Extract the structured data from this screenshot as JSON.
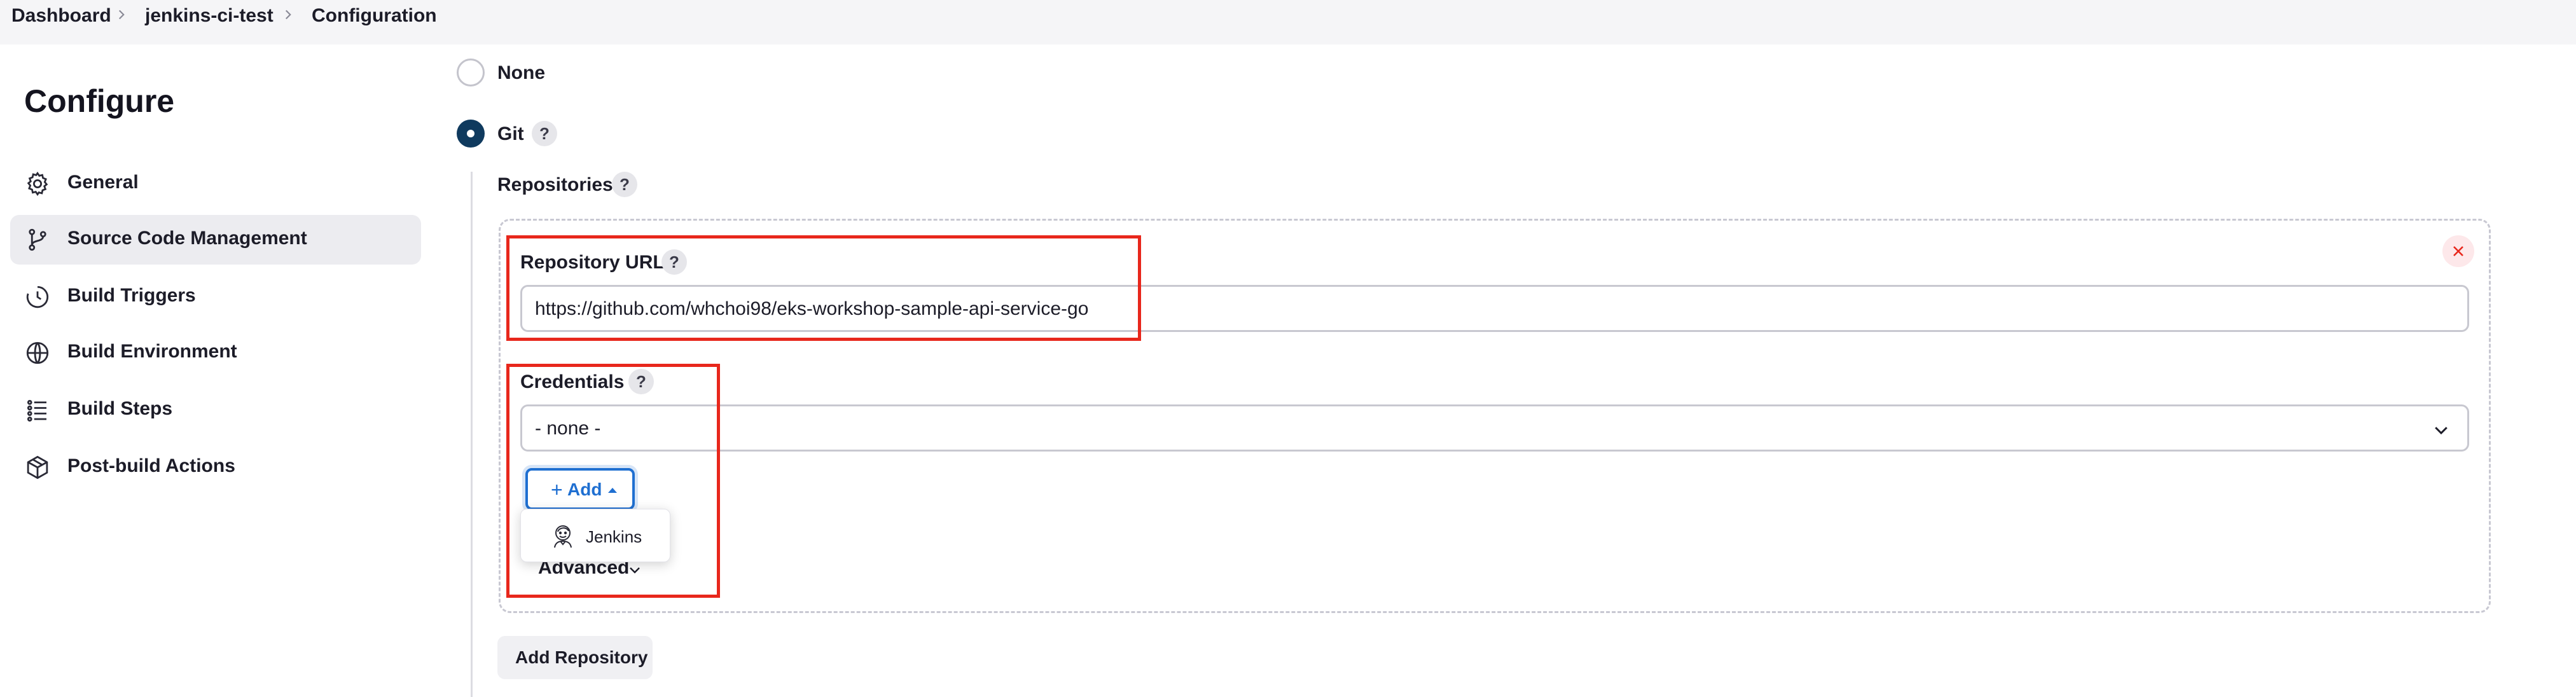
{
  "breadcrumb": {
    "items": [
      "Dashboard",
      "jenkins-ci-test",
      "Configuration"
    ]
  },
  "sidebar": {
    "title": "Configure",
    "items": [
      {
        "label": "General",
        "icon": "gear-icon"
      },
      {
        "label": "Source Code Management",
        "icon": "branch-icon",
        "active": true
      },
      {
        "label": "Build Triggers",
        "icon": "timer-icon"
      },
      {
        "label": "Build Environment",
        "icon": "globe-icon"
      },
      {
        "label": "Build Steps",
        "icon": "list-icon"
      },
      {
        "label": "Post-build Actions",
        "icon": "package-icon"
      }
    ]
  },
  "scm": {
    "options": [
      {
        "label": "None",
        "selected": false
      },
      {
        "label": "Git",
        "selected": true
      }
    ],
    "help_glyph": "?",
    "repositories_label": "Repositories",
    "repository_url_label": "Repository URL",
    "repository_url_value": "https://github.com/whchoi98/eks-workshop-sample-api-service-go",
    "credentials_label": "Credentials",
    "credentials_value": "- none -",
    "add_button": {
      "plus": "+",
      "label": "Add"
    },
    "add_menu": [
      {
        "label": "Jenkins",
        "icon": "jenkins-icon"
      }
    ],
    "advanced_label": "Advanced",
    "add_repository_label": "Add Repository"
  },
  "colors": {
    "highlight": "#e8271c",
    "accent": "#1f6fd1",
    "radio_selected": "#0f3a5e"
  }
}
